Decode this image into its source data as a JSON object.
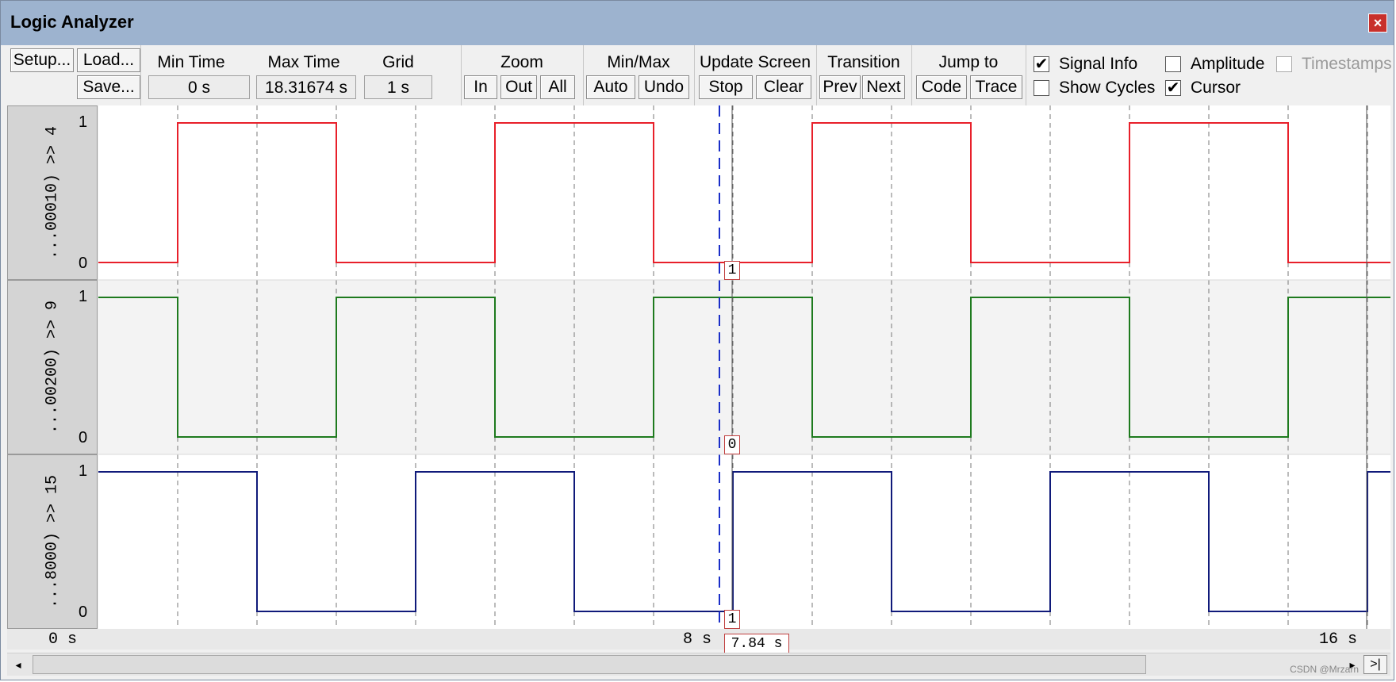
{
  "window": {
    "title": "Logic Analyzer",
    "close_glyph": "×"
  },
  "toolbar": {
    "setup": "Setup...",
    "load": "Load...",
    "save": "Save...",
    "min_time_label": "Min Time",
    "min_time_value": "0 s",
    "max_time_label": "Max Time",
    "max_time_value": "18.31674 s",
    "grid_label": "Grid",
    "grid_value": "1 s",
    "zoom_label": "Zoom",
    "zoom_in": "In",
    "zoom_out": "Out",
    "zoom_all": "All",
    "minmax_label": "Min/Max",
    "auto": "Auto",
    "undo": "Undo",
    "update_label": "Update Screen",
    "stop": "Stop",
    "clear": "Clear",
    "transition_label": "Transition",
    "prev": "Prev",
    "next": "Next",
    "jump_label": "Jump to",
    "code": "Code",
    "trace": "Trace",
    "opts": {
      "signal_info": {
        "label": "Signal Info",
        "checked": true
      },
      "show_cycles": {
        "label": "Show Cycles",
        "checked": false
      },
      "amplitude": {
        "label": "Amplitude",
        "checked": false
      },
      "cursor": {
        "label": "Cursor",
        "checked": true
      },
      "timestamps": {
        "label": "Timestamps",
        "checked": false,
        "disabled": true
      }
    }
  },
  "channels": [
    {
      "label": "...00010) >> 4",
      "color": "#e8202a",
      "high": "1",
      "low": "0",
      "cursor_value": "1"
    },
    {
      "label": "...00200) >> 9",
      "color": "#1e7a1e",
      "high": "1",
      "low": "0",
      "cursor_value": "0"
    },
    {
      "label": "...8000) >> 15",
      "color": "#101a7a",
      "high": "1",
      "low": "0",
      "cursor_value": "1"
    }
  ],
  "time_axis": {
    "start": "0 s",
    "mid": "8 s",
    "end": "16 s",
    "cursor_time": "7.84 s"
  },
  "scrollbar": {
    "left_arrow": "◂",
    "right_arrow": "▸",
    "end_button": ">|"
  },
  "watermark": "CSDN @Mrzarn"
}
